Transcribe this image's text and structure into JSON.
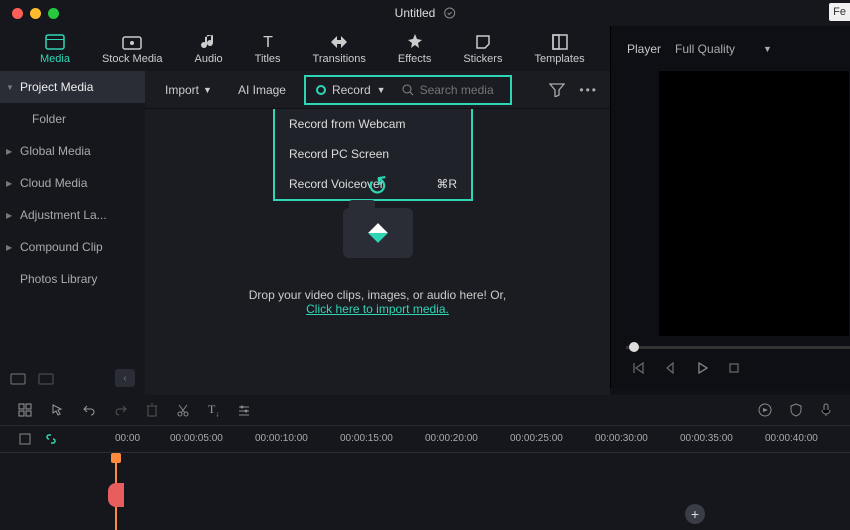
{
  "titlebar": {
    "title": "Untitled",
    "fe_button": "Fe"
  },
  "tabs": [
    {
      "id": "media",
      "label": "Media"
    },
    {
      "id": "stock",
      "label": "Stock Media"
    },
    {
      "id": "audio",
      "label": "Audio"
    },
    {
      "id": "titles",
      "label": "Titles"
    },
    {
      "id": "transitions",
      "label": "Transitions"
    },
    {
      "id": "effects",
      "label": "Effects"
    },
    {
      "id": "stickers",
      "label": "Stickers"
    },
    {
      "id": "templates",
      "label": "Templates"
    }
  ],
  "sidebar": {
    "header": "Project Media",
    "folder": "Folder",
    "items": [
      {
        "label": "Global Media"
      },
      {
        "label": "Cloud Media"
      },
      {
        "label": "Adjustment La..."
      },
      {
        "label": "Compound Clip"
      }
    ],
    "photos": "Photos Library"
  },
  "toolbar": {
    "import": "Import",
    "ai_image": "AI Image",
    "record": "Record",
    "search_placeholder": "Search media"
  },
  "record_menu": [
    {
      "label": "Record from Webcam",
      "shortcut": ""
    },
    {
      "label": "Record PC Screen",
      "shortcut": ""
    },
    {
      "label": "Record Voiceover",
      "shortcut": "⌘R"
    }
  ],
  "dropzone": {
    "text": "Drop your video clips, images, or audio here! Or,",
    "link": "Click here to import media."
  },
  "player": {
    "label": "Player",
    "quality": "Full Quality"
  },
  "timeline": {
    "marks": [
      "00:00",
      "00:00:05:00",
      "00:00:10:00",
      "00:00:15:00",
      "00:00:20:00",
      "00:00:25:00",
      "00:00:30:00",
      "00:00:35:00",
      "00:00:40:00"
    ]
  }
}
